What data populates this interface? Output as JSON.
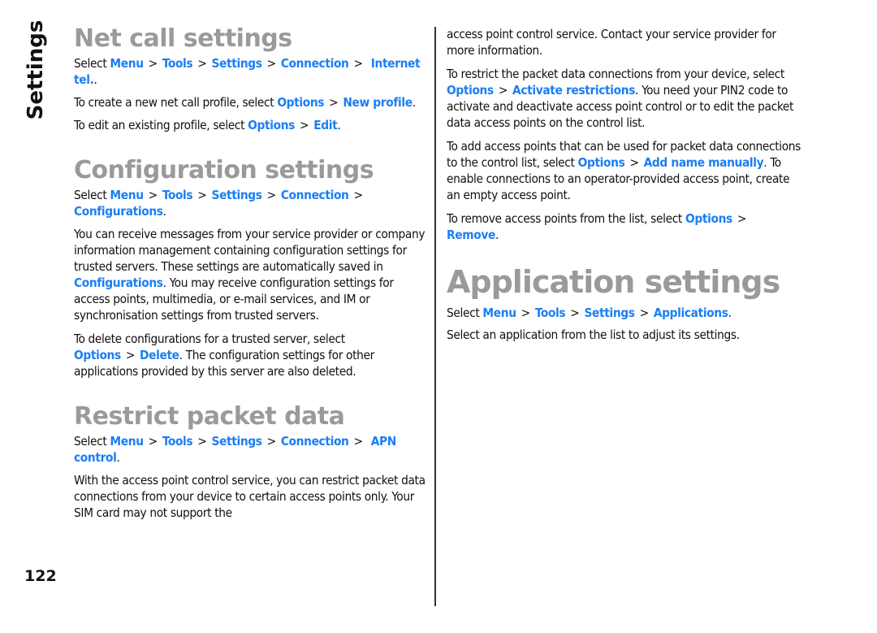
{
  "side_tab": "Settings",
  "page_number": "122",
  "colors": {
    "link": "#1a7ef5",
    "heading": "#9a9a9a",
    "text": "#111111"
  },
  "sections": {
    "net_call": {
      "title": "Net call settings",
      "path": {
        "select": "Select",
        "items": [
          "Menu",
          "Tools",
          "Settings",
          "Connection",
          "Internet tel."
        ],
        "end": "."
      },
      "new_profile": {
        "pre": "To create a new net call profile, select",
        "link1": "Options",
        "link2": "New profile",
        "end": "."
      },
      "edit_profile": {
        "pre": "To edit an existing profile, select",
        "link1": "Options",
        "link2": "Edit",
        "end": "."
      }
    },
    "configuration": {
      "title": "Configuration settings",
      "path": {
        "select": "Select",
        "items": [
          "Menu",
          "Tools",
          "Settings",
          "Connection",
          "Configurations"
        ],
        "end": "."
      },
      "receive": {
        "pre": "You can receive messages from your service provider or company information management containing configuration settings for trusted servers. These settings are automatically saved in",
        "link": "Configurations",
        "post": ". You may receive configuration settings for access points, multimedia, or e-mail services, and IM or synchronisation settings from trusted servers."
      },
      "delete": {
        "pre": "To delete configurations for a trusted server, select",
        "link1": "Options",
        "link2": "Delete",
        "post": ". The configuration settings for other applications provided by this server are also deleted."
      }
    },
    "restrict": {
      "title": "Restrict packet data",
      "path": {
        "select": "Select",
        "items": [
          "Menu",
          "Tools",
          "Settings",
          "Connection",
          "APN control"
        ],
        "end": "."
      },
      "intro": "With the access point control service, you can restrict packet data connections from your device to certain access points only. Your SIM card may not support the access point control service. Contact your service provider for more information.",
      "activate": {
        "pre": "To restrict the packet data connections from your device, select",
        "link1": "Options",
        "link2": "Activate restrictions",
        "post": ". You need your PIN2 code to activate and deactivate access point control or to edit the packet data access points on the control list."
      },
      "add": {
        "pre": "To add access points that can be used for packet data connections to the control list, select",
        "link1": "Options",
        "link2": "Add name manually",
        "post": ". To enable connections to an operator-provided access point, create an empty access point."
      },
      "remove": {
        "pre": "To remove access points from the list, select",
        "link1": "Options",
        "link2": "Remove",
        "end": "."
      }
    },
    "application": {
      "title": "Application settings",
      "path": {
        "select": "Select",
        "items": [
          "Menu",
          "Tools",
          "Settings",
          "Applications"
        ],
        "end": "."
      },
      "desc": "Select an application from the list to adjust its settings."
    }
  },
  "intro_split": {
    "left": "With the access point control service, you can restrict packet data connections from your device to certain access points only. Your SIM card may not support the",
    "right": "access point control service. Contact your service provider for more information."
  },
  "separator": ">"
}
